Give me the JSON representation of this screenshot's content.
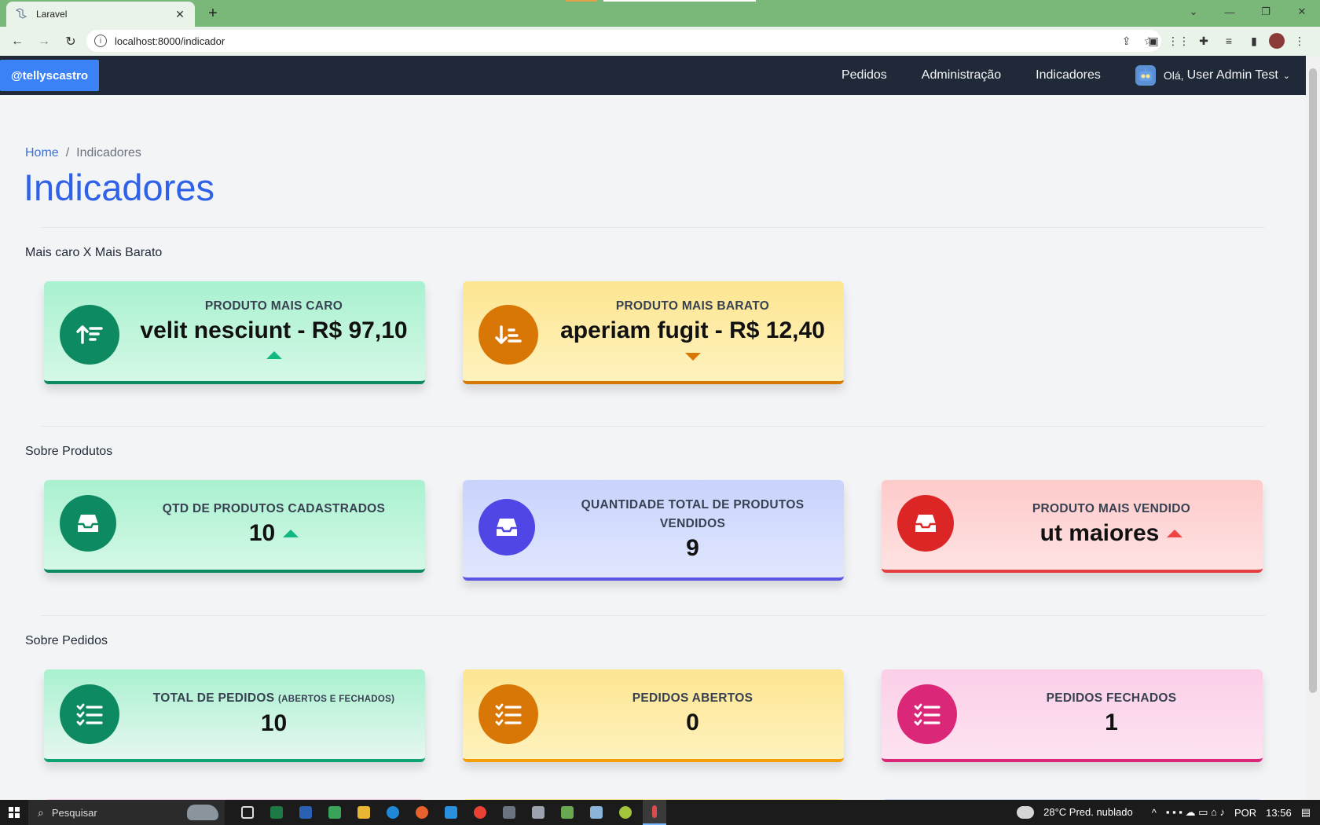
{
  "browser": {
    "tab_title": "Laravel",
    "tab_close": "✕",
    "new_tab": "+",
    "url": "localhost:8000/indicador",
    "window_controls": [
      "⌄",
      "—",
      "❐",
      "✕"
    ]
  },
  "navbar": {
    "brand": "@tellyscastro",
    "links": [
      "Pedidos",
      "Administração",
      "Indicadores"
    ],
    "greeting_small": "Olá,",
    "user_name": "User Admin Test"
  },
  "breadcrumb": {
    "home": "Home",
    "separator": "/",
    "current": "Indicadores"
  },
  "page_title": "Indicadores",
  "sections": {
    "price": {
      "title": "Mais caro X Mais Barato",
      "cards": [
        {
          "label": "PRODUTO MAIS CARO",
          "value": "velit nesciunt - R$ 97,10",
          "trend": "up",
          "color": "green",
          "icon": "sort-ascending-icon"
        },
        {
          "label": "PRODUTO MAIS BARATO",
          "value": "aperiam fugit - R$ 12,40",
          "trend": "down",
          "color": "yellow",
          "icon": "sort-descending-icon"
        }
      ]
    },
    "products": {
      "title": "Sobre Produtos",
      "cards": [
        {
          "label": "QTD DE PRODUTOS CADASTRADOS",
          "value": "10",
          "trend": "up",
          "color": "green",
          "icon": "inbox-icon"
        },
        {
          "label": "QUANTIDADE TOTAL DE PRODUTOS VENDIDOS",
          "value": "9",
          "trend": "none",
          "color": "indigo",
          "icon": "inbox-icon"
        },
        {
          "label": "PRODUTO MAIS VENDIDO",
          "value": "ut maiores",
          "trend": "up",
          "color": "red",
          "icon": "inbox-icon"
        }
      ]
    },
    "orders": {
      "title": "Sobre Pedidos",
      "cards": [
        {
          "label": "TOTAL DE PEDIDOS",
          "label_small": "(ABERTOS E FECHADOS)",
          "value": "10",
          "color": "green",
          "icon": "checklist-icon"
        },
        {
          "label": "PEDIDOS ABERTOS",
          "value": "0",
          "color": "yellow",
          "icon": "checklist-icon"
        },
        {
          "label": "PEDIDOS FECHADOS",
          "value": "1",
          "color": "pink",
          "icon": "checklist-icon"
        }
      ]
    }
  },
  "colors": {
    "accent_blue": "#2f62e8",
    "trend_up_green": "#10b981",
    "trend_down_orange": "#d97706",
    "trend_up_red": "#ef4444"
  },
  "taskbar": {
    "search_placeholder": "Pesquisar",
    "weather": "28°C Pred. nublado",
    "language": "POR",
    "time": "13:56"
  }
}
